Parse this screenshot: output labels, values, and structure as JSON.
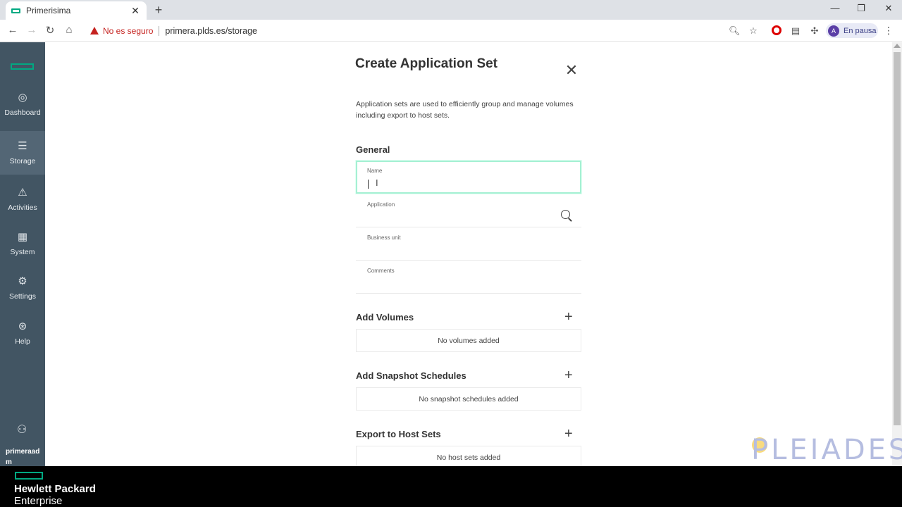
{
  "browser": {
    "tab_title": "Primerisima",
    "tab_close": "✕",
    "new_tab": "+",
    "window": {
      "minimize": "—",
      "restore": "❐",
      "close": "✕"
    },
    "nav": {
      "back": "←",
      "forward": "→",
      "reload": "↻",
      "home": "⌂"
    },
    "security_text": "No es seguro",
    "url": "primera.plds.es/storage",
    "profile_initial": "A",
    "profile_status": "En pausa",
    "icons": {
      "zoom": "search-icon",
      "bookmark": "star-icon",
      "extensions": "puzzle-icon",
      "menu": "kebab-icon"
    }
  },
  "sidebar": {
    "items": [
      {
        "label": "Dashboard",
        "icon": "◎"
      },
      {
        "label": "Storage",
        "icon": "☰"
      },
      {
        "label": "Activities",
        "icon": "⚠"
      },
      {
        "label": "System",
        "icon": "▦"
      },
      {
        "label": "Settings",
        "icon": "⚙"
      },
      {
        "label": "Help",
        "icon": "⊛"
      }
    ],
    "user_name": "primeraadm"
  },
  "dialog": {
    "title": "Create Application Set",
    "close": "✕",
    "description": "Application sets are used to efficiently group and manage volumes including export to host sets.",
    "general_heading": "General",
    "fields": {
      "name_label": "Name",
      "application_label": "Application",
      "business_unit_label": "Business unit",
      "comments_label": "Comments"
    },
    "volumes": {
      "heading": "Add Volumes",
      "empty": "No volumes added"
    },
    "snapshots": {
      "heading": "Add Snapshot Schedules",
      "empty": "No snapshot schedules added"
    },
    "host_sets": {
      "heading": "Export to Host Sets",
      "empty": "No host sets added"
    },
    "add_symbol": "+"
  },
  "watermark": "PLEIADES",
  "footer": {
    "line1": "Hewlett Packard",
    "line2": "Enterprise"
  }
}
